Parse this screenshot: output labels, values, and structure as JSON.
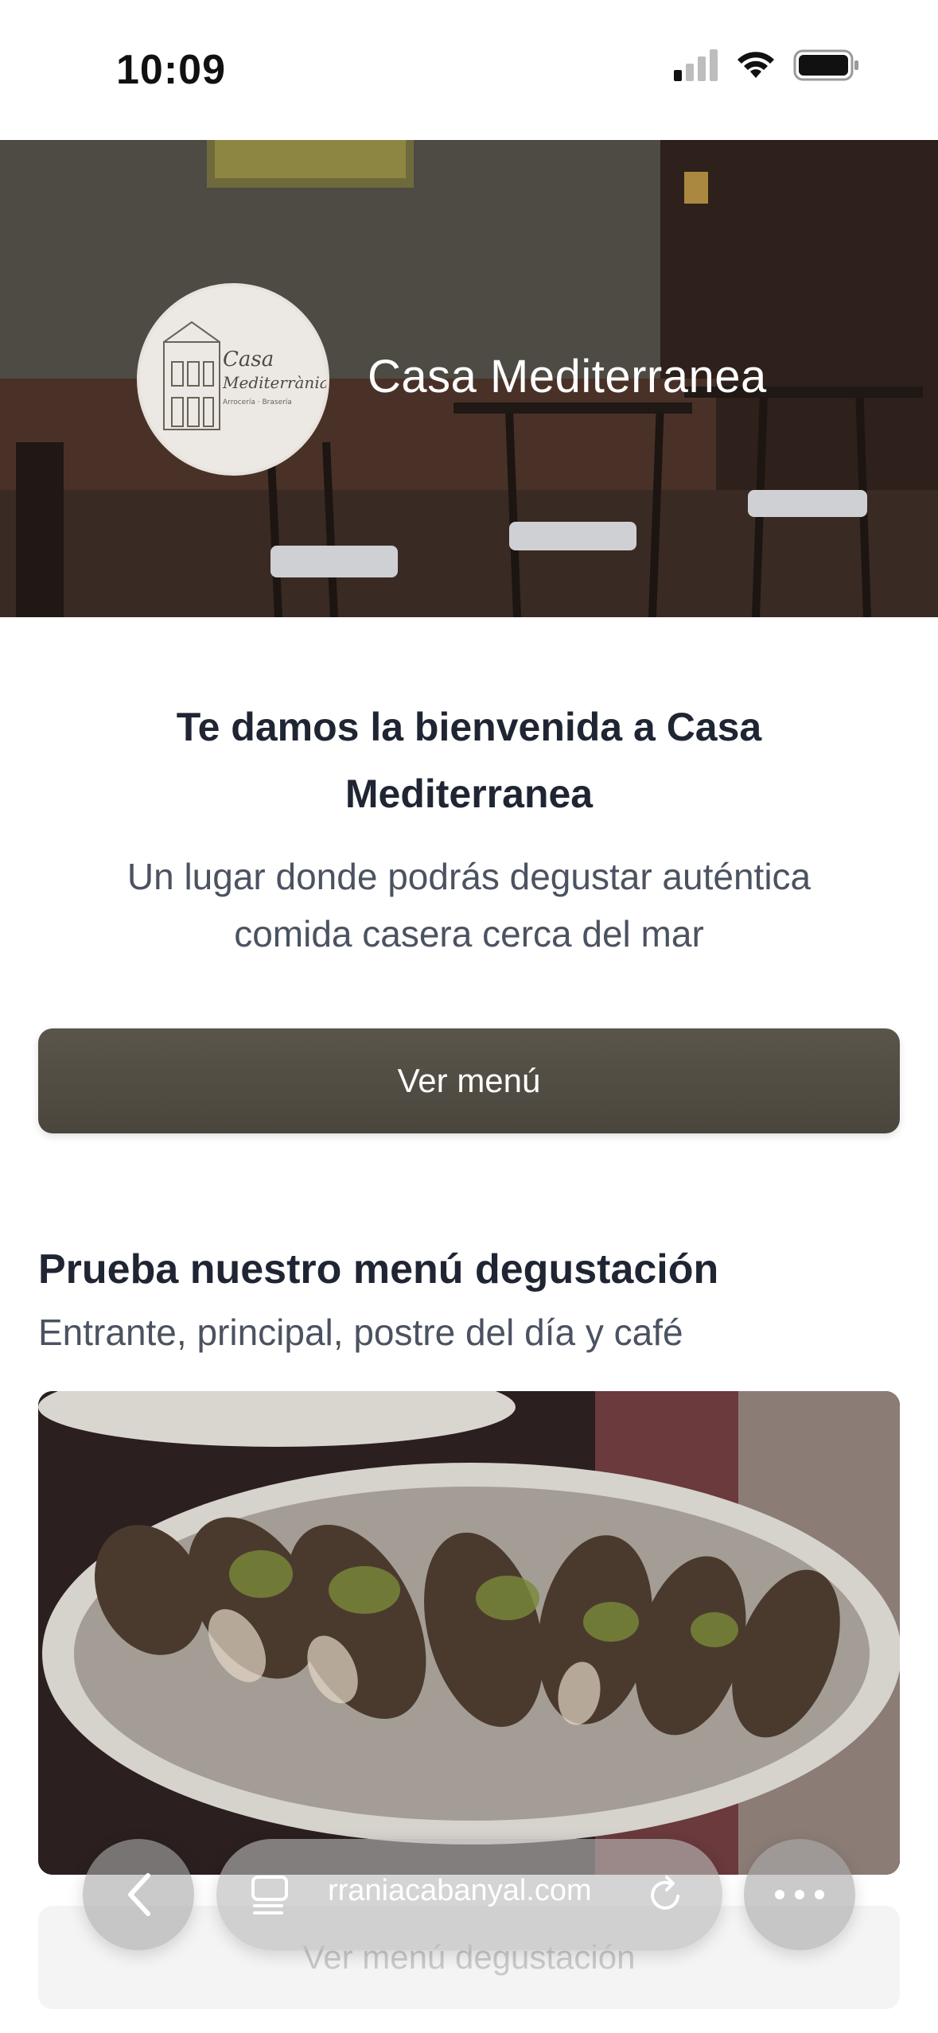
{
  "status_bar": {
    "time": "10:09"
  },
  "hero": {
    "restaurant_name": "Casa Mediterranea",
    "logo": {
      "line1": "Casa",
      "line2": "Mediterrània",
      "tagline": "Arrocería · Brasería"
    }
  },
  "welcome": {
    "title_line1": "Te damos la bienvenida a Casa",
    "title_line2": "Mediterranea",
    "subtitle_line1": "Un lugar donde podrás degustar auténtica",
    "subtitle_line2": "comida casera cerca del mar"
  },
  "menu_button_label": "Ver menú",
  "tasting": {
    "title": "Prueba nuestro menú degustación",
    "subtitle": "Entrante, principal, postre del día y café",
    "button_label": "Ver menú degustación"
  },
  "browser": {
    "url": "rraniacabanyal.com"
  },
  "colors": {
    "accent_button": "#4f4b42",
    "heading": "#1f2533",
    "body_text": "#4b5260"
  }
}
